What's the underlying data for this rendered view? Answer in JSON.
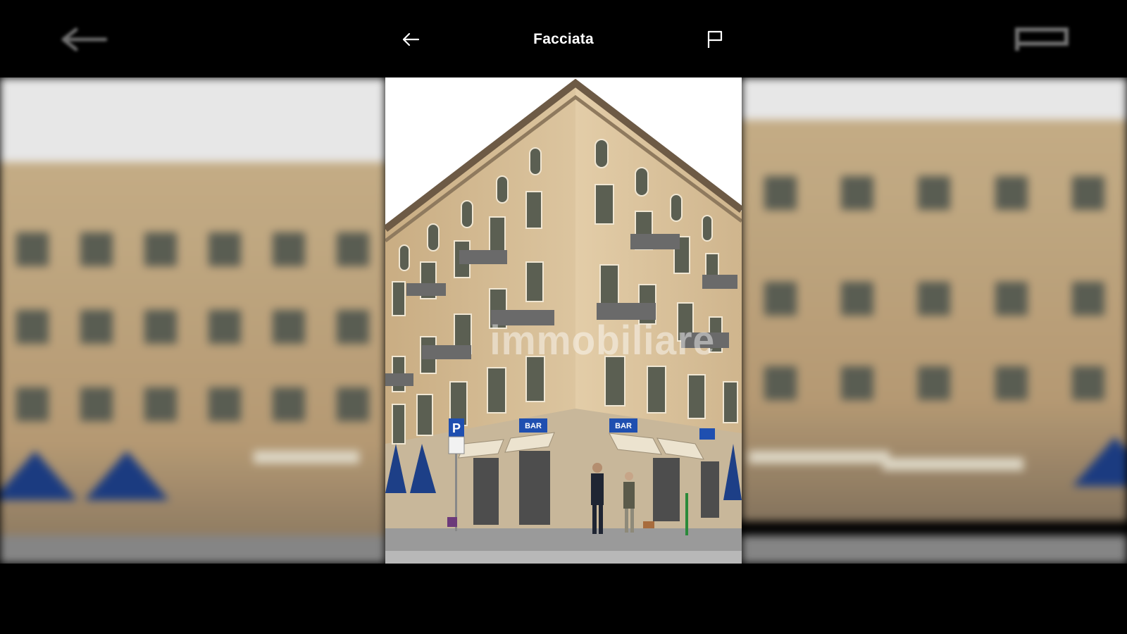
{
  "header": {
    "title": "Facciata"
  },
  "icons": {
    "back": "arrow-left-icon",
    "report": "flag-icon"
  },
  "photo": {
    "watermark": "immobiliare",
    "shop_sign_left": "BAR",
    "shop_sign_right": "BAR",
    "parking_sign": "P"
  },
  "colors": {
    "background": "#000000",
    "title_text": "#ffffff",
    "facade": "#d9c29a",
    "sign_blue": "#1f4fb0"
  }
}
